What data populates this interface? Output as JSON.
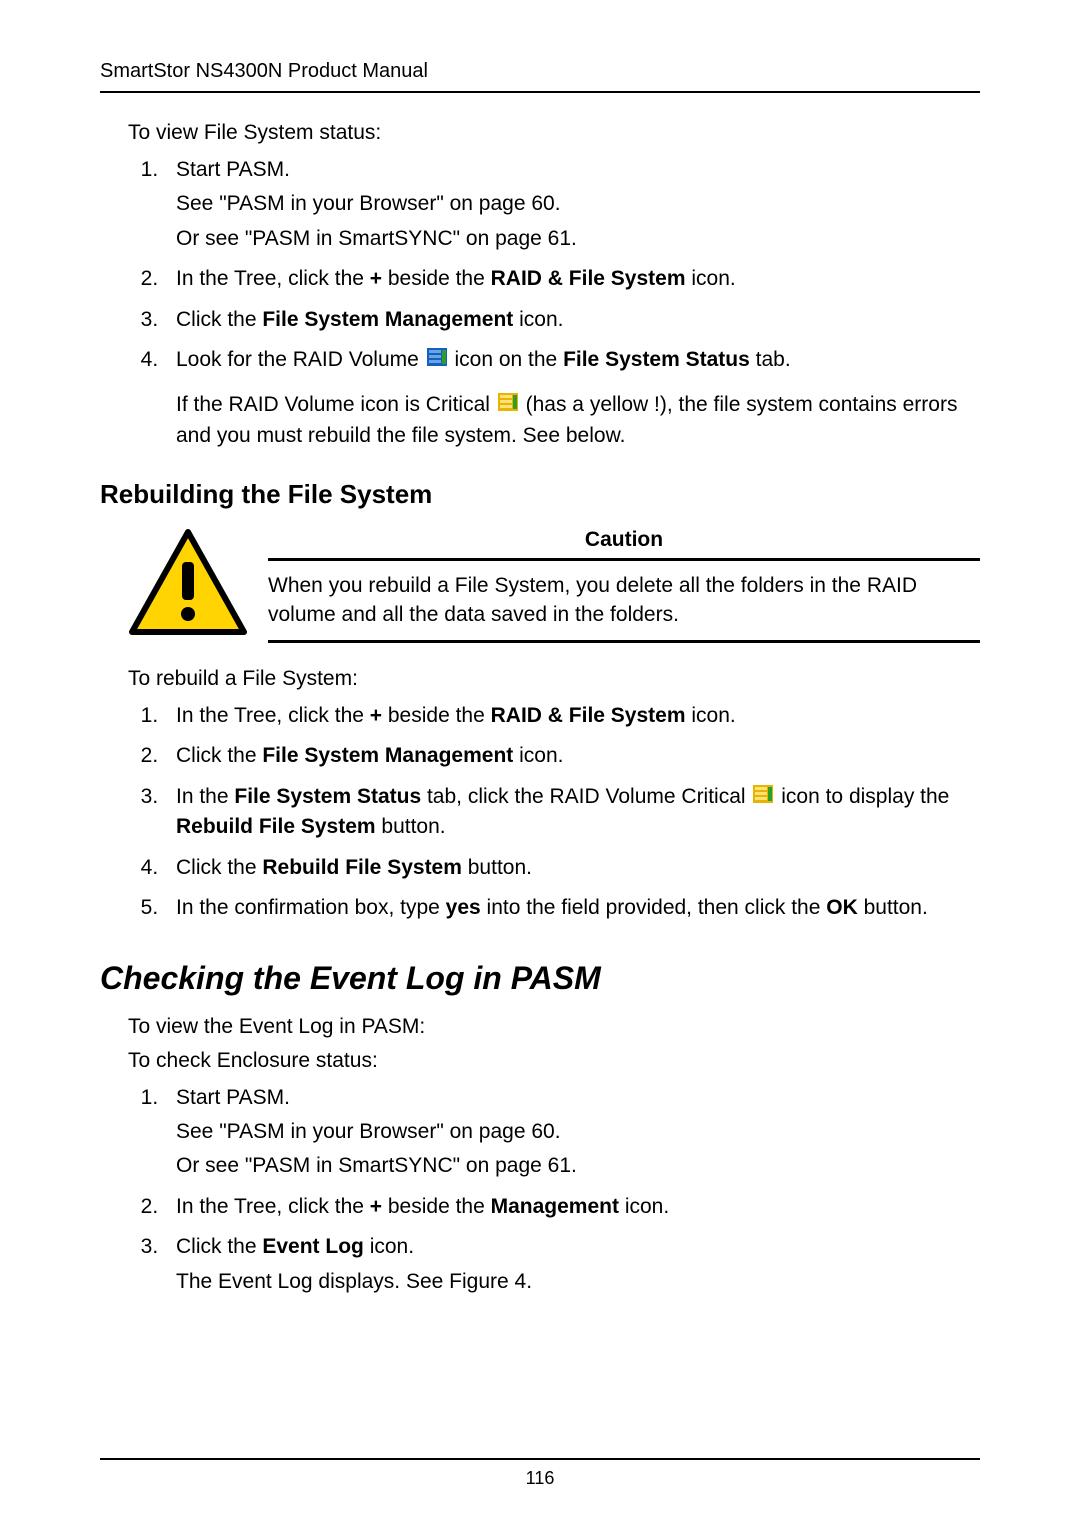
{
  "header": {
    "title": "SmartStor NS4300N Product Manual"
  },
  "section1": {
    "intro": "To view File System status:",
    "steps": [
      {
        "main": "Start PASM.",
        "sub1": "See \"PASM in your Browser\" on page 60.",
        "sub2": "Or see \"PASM in SmartSYNC\" on page 61."
      },
      {
        "prefix": "In the Tree, click the ",
        "plus": "+",
        "mid": " beside the ",
        "bold": "RAID & File System",
        "suffix": " icon."
      },
      {
        "prefix": "Click the ",
        "bold": "File System Management",
        "suffix": " icon."
      },
      {
        "prefix": "Look for the RAID Volume ",
        "mid": " icon on the ",
        "bold": "File System Status",
        "suffix": " tab.",
        "gap1a": "If the RAID Volume icon is Critical ",
        "gap1b": " (has a yellow !), the file system contains errors and you must rebuild the file system. See below."
      }
    ]
  },
  "subhead": "Rebuilding the File System",
  "caution": {
    "title": "Caution",
    "text": "When you rebuild a File System, you delete all the folders in the RAID volume and all the data saved in the folders."
  },
  "section2": {
    "intro": "To rebuild a File System:",
    "steps": [
      {
        "prefix": "In the Tree, click the ",
        "plus": "+",
        "mid": " beside the ",
        "bold": "RAID & File System",
        "suffix": " icon."
      },
      {
        "prefix": "Click the ",
        "bold": "File System Management",
        "suffix": " icon."
      },
      {
        "prefix": "In the ",
        "bold1": "File System Status",
        "mid1": " tab, click the RAID Volume Critical ",
        "mid2": " icon to display the ",
        "bold2": "Rebuild File System",
        "suffix": " button."
      },
      {
        "prefix": "Click the ",
        "bold": "Rebuild File System",
        "suffix": " button."
      },
      {
        "prefix": "In the confirmation box, type ",
        "bold1": "yes",
        "mid": " into the field provided, then click the ",
        "bold2": "OK",
        "suffix": " button."
      }
    ]
  },
  "majorhead": "Checking the Event Log in PASM",
  "section3": {
    "intro1": "To view the Event Log in PASM:",
    "intro2": "To check Enclosure status:",
    "steps": [
      {
        "main": "Start PASM.",
        "sub1": "See \"PASM in your Browser\" on page 60.",
        "sub2": "Or see \"PASM in SmartSYNC\" on page 61."
      },
      {
        "prefix": "In the Tree, click the ",
        "plus": "+",
        "mid": " beside the ",
        "bold": "Management",
        "suffix": " icon."
      },
      {
        "prefix": "Click the ",
        "bold": "Event Log",
        "suffix": " icon.",
        "sub1": "The Event Log displays. See Figure 4."
      }
    ]
  },
  "footer": {
    "page": "116"
  }
}
